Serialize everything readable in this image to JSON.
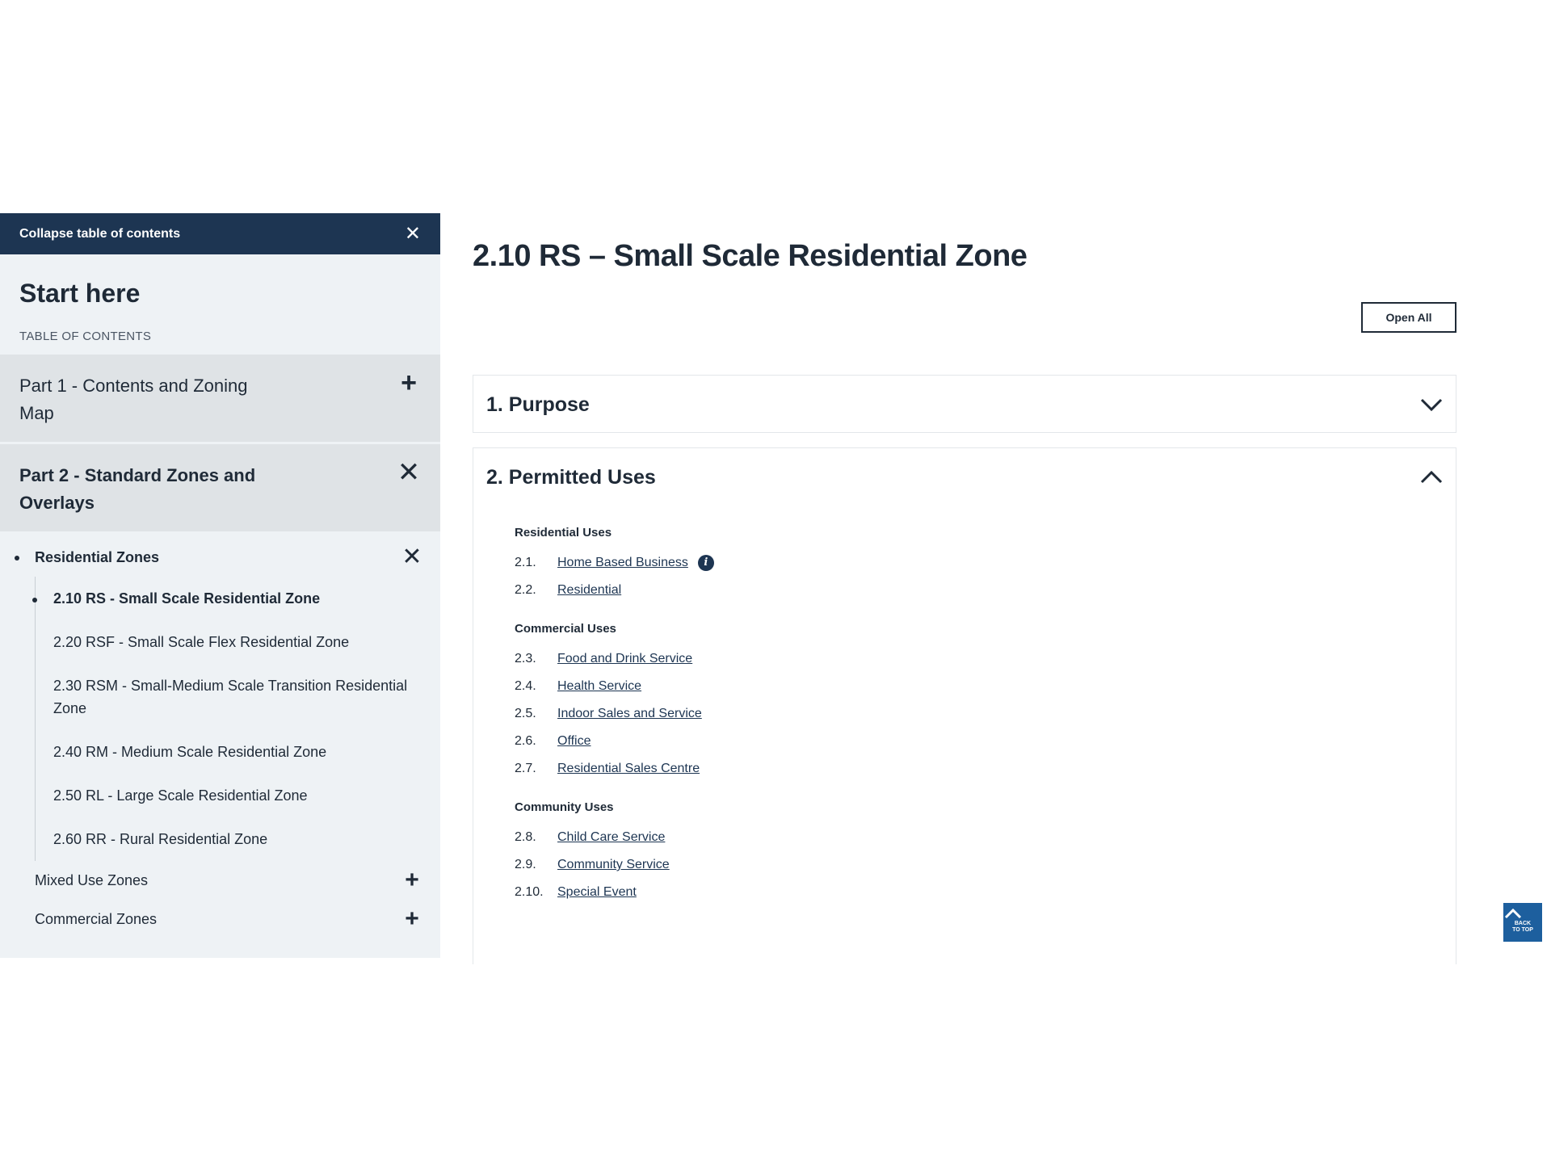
{
  "sidebar": {
    "collapse_label": "Collapse table of contents",
    "start_here": "Start here",
    "toc_label": "TABLE OF CONTENTS",
    "parts": [
      {
        "title": "Part 1 - Contents and Zoning Map",
        "state": "collapsed"
      },
      {
        "title": "Part 2 - Standard Zones and Overlays",
        "state": "expanded"
      }
    ],
    "residential_zones": "Residential Zones",
    "zones": [
      "2.10 RS - Small Scale Residential Zone",
      "2.20 RSF - Small Scale Flex Residential Zone",
      "2.30 RSM - Small-Medium Scale Transition Residential Zone",
      "2.40 RM - Medium Scale Residential Zone",
      "2.50 RL - Large Scale Residential Zone",
      "2.60 RR - Rural Residential Zone"
    ],
    "mixed_use_zones": "Mixed Use Zones",
    "commercial_zones": "Commercial Zones"
  },
  "main": {
    "title": "2.10 RS – Small Scale Residential Zone",
    "open_all": "Open All",
    "sections": [
      {
        "title": "1. Purpose",
        "state": "collapsed"
      },
      {
        "title": "2. Permitted Uses",
        "state": "expanded"
      }
    ],
    "groups": [
      {
        "title": "Residential Uses",
        "items": [
          {
            "num": "2.1.",
            "label": "Home Based Business"
          },
          {
            "num": "2.2.",
            "label": "Residential"
          }
        ]
      },
      {
        "title": "Commercial Uses",
        "items": [
          {
            "num": "2.3.",
            "label": "Food and Drink Service"
          },
          {
            "num": "2.4.",
            "label": "Health Service"
          },
          {
            "num": "2.5.",
            "label": "Indoor Sales and Service"
          },
          {
            "num": "2.6.",
            "label": "Office"
          },
          {
            "num": "2.7.",
            "label": "Residential Sales Centre"
          }
        ]
      },
      {
        "title": "Community Uses",
        "items": [
          {
            "num": "2.8.",
            "label": "Child Care Service"
          },
          {
            "num": "2.9.",
            "label": "Community Service"
          },
          {
            "num": "2.10.",
            "label": "Special Event"
          }
        ]
      }
    ]
  },
  "back_to_top": {
    "line1": "BACK",
    "line2": "TO TOP"
  },
  "icons": {
    "close": "close-icon",
    "plus": "plus-icon",
    "chevron_down": "chevron-down-icon",
    "chevron_up": "chevron-up-icon",
    "info": "info-icon",
    "arrow_up": "arrow-up-icon"
  },
  "colors": {
    "navy": "#1d3552",
    "sidebar_bg": "#eef2f5",
    "part_bg": "#dfe3e6",
    "back_to_top": "#1d5f9e"
  }
}
